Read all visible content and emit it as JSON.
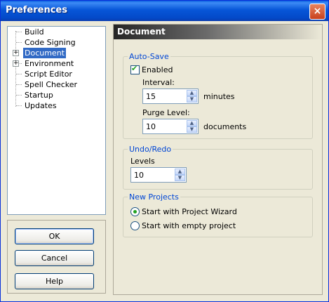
{
  "window": {
    "title": "Preferences",
    "close_glyph": "×"
  },
  "tree": {
    "items": [
      {
        "label": "Build"
      },
      {
        "label": "Code Signing"
      },
      {
        "label": "Document",
        "selected": true,
        "expandable": true
      },
      {
        "label": "Environment",
        "expandable": true
      },
      {
        "label": "Script Editor"
      },
      {
        "label": "Spell Checker"
      },
      {
        "label": "Startup"
      },
      {
        "label": "Updates"
      }
    ]
  },
  "buttons": {
    "ok": "OK",
    "cancel": "Cancel",
    "help": "Help"
  },
  "panel": {
    "title": "Document"
  },
  "autosave": {
    "group_label": "Auto-Save",
    "enabled_label": "Enabled",
    "enabled": true,
    "interval_label": "Interval:",
    "interval_value": "15",
    "interval_unit": "minutes",
    "purge_label": "Purge Level:",
    "purge_value": "10",
    "purge_unit": "documents"
  },
  "undo": {
    "group_label": "Undo/Redo",
    "levels_label": "Levels",
    "levels_value": "10"
  },
  "new_projects": {
    "group_label": "New Projects",
    "option_wizard": "Start with Project Wizard",
    "option_empty": "Start with empty project",
    "selected": "wizard"
  },
  "colors": {
    "accent": "#316ac5",
    "group_label": "#0046d5",
    "check": "#21a121"
  }
}
